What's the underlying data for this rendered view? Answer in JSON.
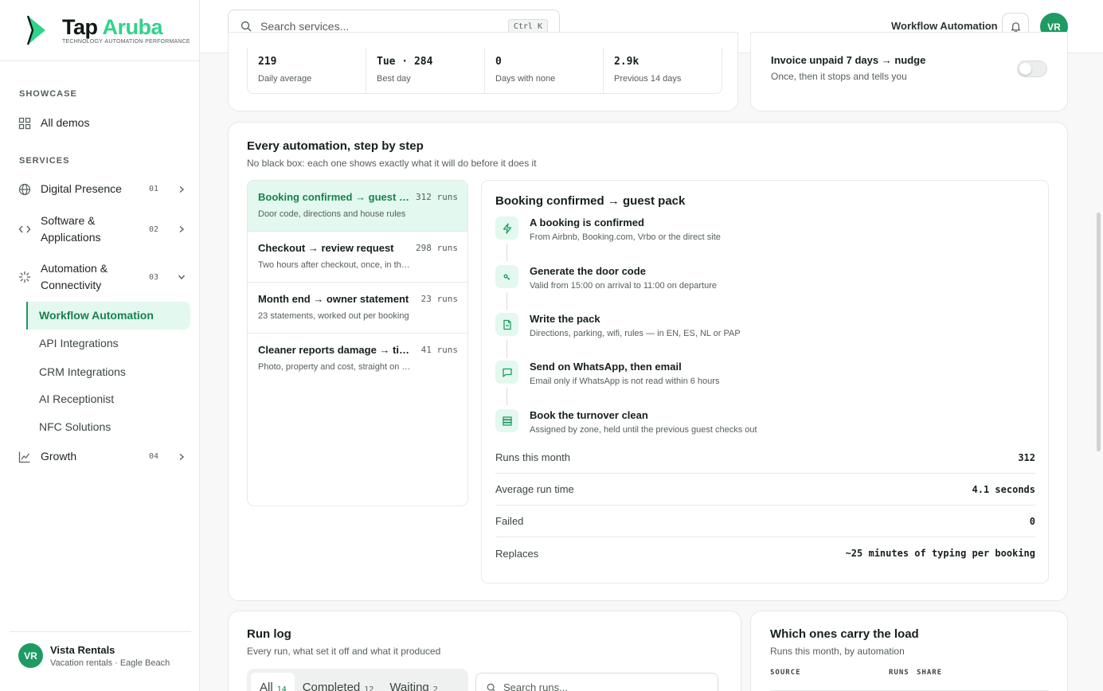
{
  "brand": {
    "word1": "Tap",
    "word2": "Aruba",
    "tagline": "TECHNOLOGY·AUTOMATION·PERFORMANCE",
    "accent": "#2fd48a",
    "green": "#1f9a63"
  },
  "sidebar": {
    "showcase_label": "SHOWCASE",
    "all_demos": "All demos",
    "services_label": "SERVICES",
    "items": [
      {
        "label": "Digital Presence",
        "num": "01",
        "icon": "globe-icon"
      },
      {
        "label": "Software & Applications",
        "num": "02",
        "icon": "code-icon"
      },
      {
        "label": "Automation & Connectivity",
        "num": "03",
        "icon": "sparkle-icon"
      },
      {
        "label": "Growth",
        "num": "04",
        "icon": "chart-line-icon"
      }
    ],
    "sub_items": [
      "Workflow Automation",
      "API Integrations",
      "CRM Integrations",
      "AI Receptionist",
      "NFC Solutions"
    ],
    "account": {
      "initials": "VR",
      "name": "Vista Rentals",
      "sub": "Vacation rentals · Eagle Beach"
    }
  },
  "topbar": {
    "search_placeholder": "Search services...",
    "shortcut": "Ctrl K",
    "title": "Workflow Automation",
    "avatar": "VR"
  },
  "stats": [
    {
      "value": "219",
      "label": "Daily average"
    },
    {
      "value": "Tue · 284",
      "label": "Best day"
    },
    {
      "value": "0",
      "label": "Days with none"
    },
    {
      "value": "2.9k",
      "label": "Previous 14 days"
    }
  ],
  "nudge": {
    "title": "Invoice unpaid 7 days → nudge",
    "sub": "Once, then it stops and tells you",
    "enabled": false
  },
  "automations": {
    "title": "Every automation, step by step",
    "subtitle": "No black box: each one shows exactly what it will do before it does it",
    "list": [
      {
        "name": "Booking confirmed → guest pack",
        "runs": "312 runs",
        "desc": "Door code, directions and house rules"
      },
      {
        "name": "Checkout → review request",
        "runs": "298 runs",
        "desc": "Two hours after checkout, once, in their language"
      },
      {
        "name": "Month end → owner statement",
        "runs": "23 runs",
        "desc": "23 statements, worked out per booking"
      },
      {
        "name": "Cleaner reports damage → ticket",
        "runs": "41 runs",
        "desc": "Photo, property and cost, straight on the ticket"
      }
    ],
    "detail": {
      "title": "Booking confirmed → guest pack",
      "steps": [
        {
          "title": "A booking is confirmed",
          "sub": "From Airbnb, Booking.com, Vrbo or the direct site",
          "icon": "bolt-icon"
        },
        {
          "title": "Generate the door code",
          "sub": "Valid from 15:00 on arrival to 11:00 on departure",
          "icon": "key-icon"
        },
        {
          "title": "Write the pack",
          "sub": "Directions, parking, wifi, rules — in EN, ES, NL or PAP",
          "icon": "document-icon"
        },
        {
          "title": "Send on WhatsApp, then email",
          "sub": "Email only if WhatsApp is not read within 6 hours",
          "icon": "chat-icon"
        },
        {
          "title": "Book the turnover clean",
          "sub": "Assigned by zone, held until the previous guest checks out",
          "icon": "layers-icon"
        }
      ],
      "metrics": [
        {
          "k": "Runs this month",
          "v": "312"
        },
        {
          "k": "Average run time",
          "v": "4.1 seconds"
        },
        {
          "k": "Failed",
          "v": "0"
        },
        {
          "k": "Replaces",
          "v": "~25 minutes of typing per booking"
        }
      ]
    }
  },
  "runlog": {
    "title": "Run log",
    "subtitle": "Every run, what set it off and what it produced",
    "tabs": [
      {
        "label": "All",
        "count": "14"
      },
      {
        "label": "Completed",
        "count": "12"
      },
      {
        "label": "Waiting",
        "count": "2"
      }
    ],
    "search_placeholder": "Search runs..."
  },
  "load": {
    "title": "Which ones carry the load",
    "subtitle": "Runs this month, by automation",
    "col_source": "SOURCE",
    "col_runs": "RUNS",
    "col_share": "SHARE"
  }
}
